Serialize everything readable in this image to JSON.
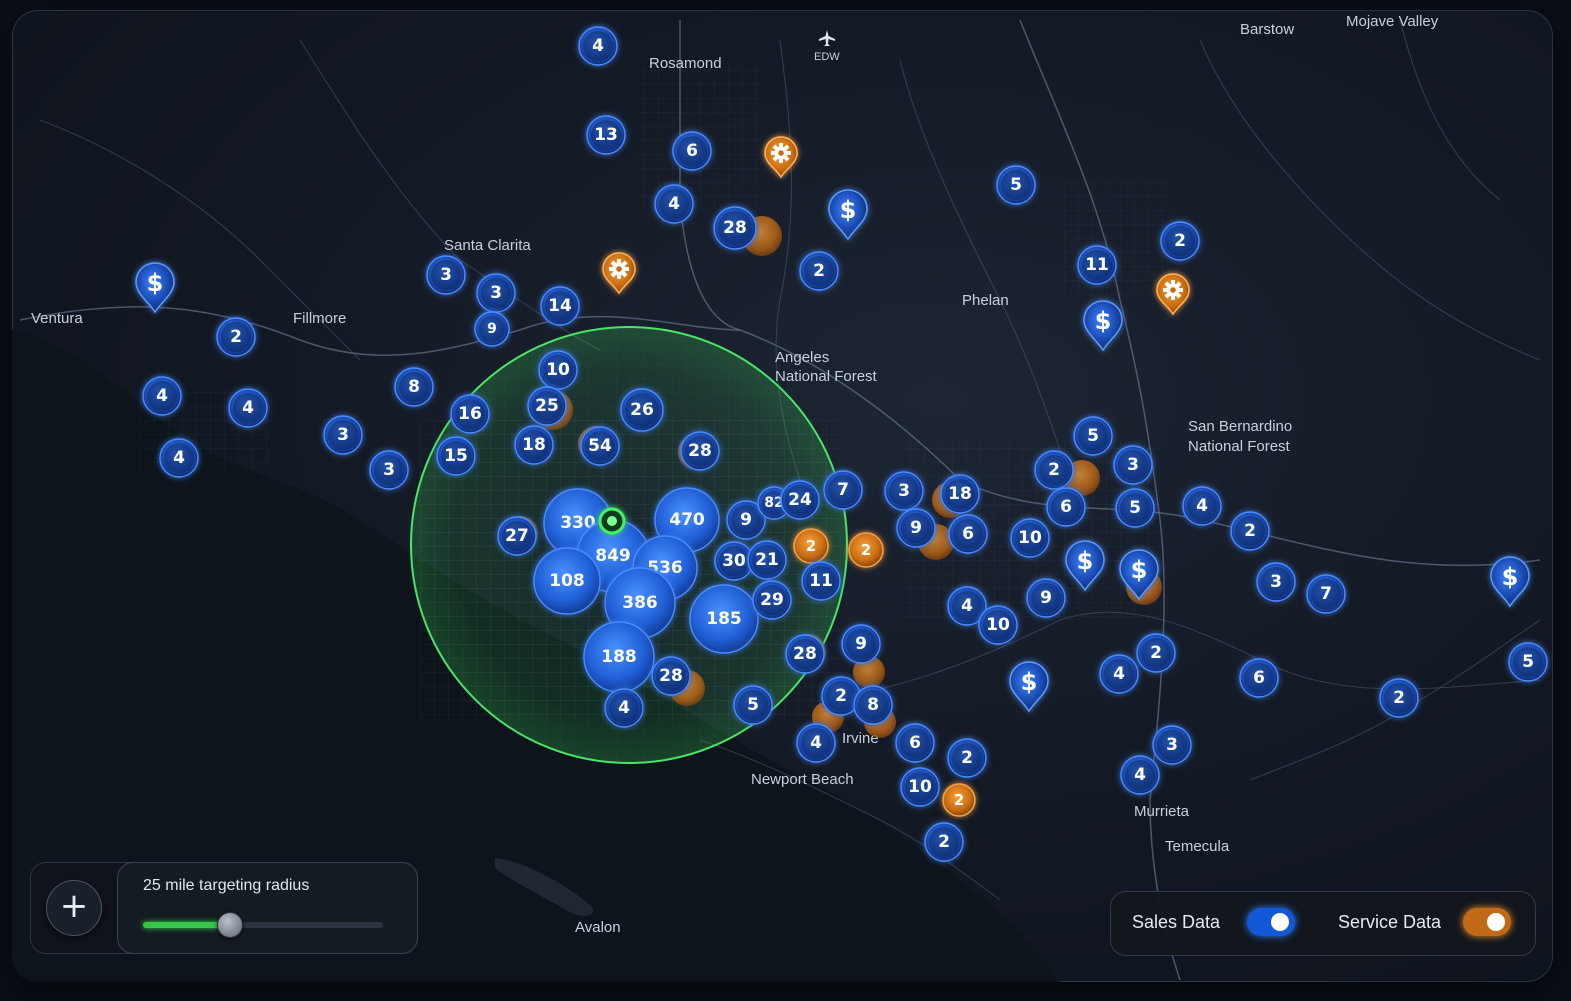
{
  "colors": {
    "sales": "#1f5fd0",
    "service": "#d7801f",
    "radius": "#3ddc59",
    "background": "#141a25"
  },
  "places": [
    {
      "name": "Rosamond"
    },
    {
      "name": "EDW"
    },
    {
      "name": "Barstow"
    },
    {
      "name": "Mojave Valley"
    },
    {
      "name": "Santa Clarita"
    },
    {
      "name": "Ventura"
    },
    {
      "name": "Fillmore"
    },
    {
      "name": "Phelan"
    },
    {
      "name": "Angeles"
    },
    {
      "name": "National Forest"
    },
    {
      "name": "San Bernardino"
    },
    {
      "name": "National Forest"
    },
    {
      "name": "Irvine"
    },
    {
      "name": "Newport Beach"
    },
    {
      "name": "Murrieta"
    },
    {
      "name": "Temecula"
    },
    {
      "name": "Avalon"
    }
  ],
  "sales_clusters": [
    {
      "count": "4"
    },
    {
      "count": "13"
    },
    {
      "count": "6"
    },
    {
      "count": "4"
    },
    {
      "count": "28"
    },
    {
      "count": "2"
    },
    {
      "count": "5"
    },
    {
      "count": "11"
    },
    {
      "count": "2"
    },
    {
      "count": "3"
    },
    {
      "count": "3"
    },
    {
      "count": "9"
    },
    {
      "count": "14"
    },
    {
      "count": "2"
    },
    {
      "count": "4"
    },
    {
      "count": "4"
    },
    {
      "count": "8"
    },
    {
      "count": "3"
    },
    {
      "count": "4"
    },
    {
      "count": "3"
    },
    {
      "count": "16"
    },
    {
      "count": "15"
    },
    {
      "count": "10"
    },
    {
      "count": "25"
    },
    {
      "count": "18"
    },
    {
      "count": "54"
    },
    {
      "count": "26"
    },
    {
      "count": "28"
    },
    {
      "count": "27"
    },
    {
      "count": "330"
    },
    {
      "count": "470"
    },
    {
      "count": "849"
    },
    {
      "count": "108"
    },
    {
      "count": "536"
    },
    {
      "count": "386"
    },
    {
      "count": "185"
    },
    {
      "count": "188"
    },
    {
      "count": "28"
    },
    {
      "count": "4"
    },
    {
      "count": "5"
    },
    {
      "count": "9"
    },
    {
      "count": "82"
    },
    {
      "count": "24"
    },
    {
      "count": "7"
    },
    {
      "count": "30"
    },
    {
      "count": "21"
    },
    {
      "count": "29"
    },
    {
      "count": "11"
    },
    {
      "count": "28"
    },
    {
      "count": "9"
    },
    {
      "count": "2"
    },
    {
      "count": "8"
    },
    {
      "count": "4"
    },
    {
      "count": "3"
    },
    {
      "count": "18"
    },
    {
      "count": "9"
    },
    {
      "count": "6"
    },
    {
      "count": "10"
    },
    {
      "count": "2"
    },
    {
      "count": "5"
    },
    {
      "count": "6"
    },
    {
      "count": "3"
    },
    {
      "count": "5"
    },
    {
      "count": "4"
    },
    {
      "count": "2"
    },
    {
      "count": "4"
    },
    {
      "count": "10"
    },
    {
      "count": "9"
    },
    {
      "count": "3"
    },
    {
      "count": "7"
    },
    {
      "count": "4"
    },
    {
      "count": "2"
    },
    {
      "count": "6"
    },
    {
      "count": "2"
    },
    {
      "count": "6"
    },
    {
      "count": "2"
    },
    {
      "count": "10"
    },
    {
      "count": "2"
    },
    {
      "count": "3"
    },
    {
      "count": "4"
    },
    {
      "count": "5"
    },
    {
      "count": "2"
    }
  ],
  "service_clusters": [
    {
      "count": "2"
    },
    {
      "count": "2"
    },
    {
      "count": "2"
    }
  ],
  "radius_control": {
    "label": "25 mile targeting radius",
    "value_fraction": 0.36,
    "zoom_in_symbol": "+"
  },
  "toggles": {
    "sales_label": "Sales Data",
    "sales_on": true,
    "service_label": "Service Data",
    "service_on": true
  },
  "icons": {
    "sales_marker": "dollar-pin-icon",
    "service_marker": "gear-pin-icon",
    "airport": "airplane-icon",
    "center": "target-center-icon"
  }
}
